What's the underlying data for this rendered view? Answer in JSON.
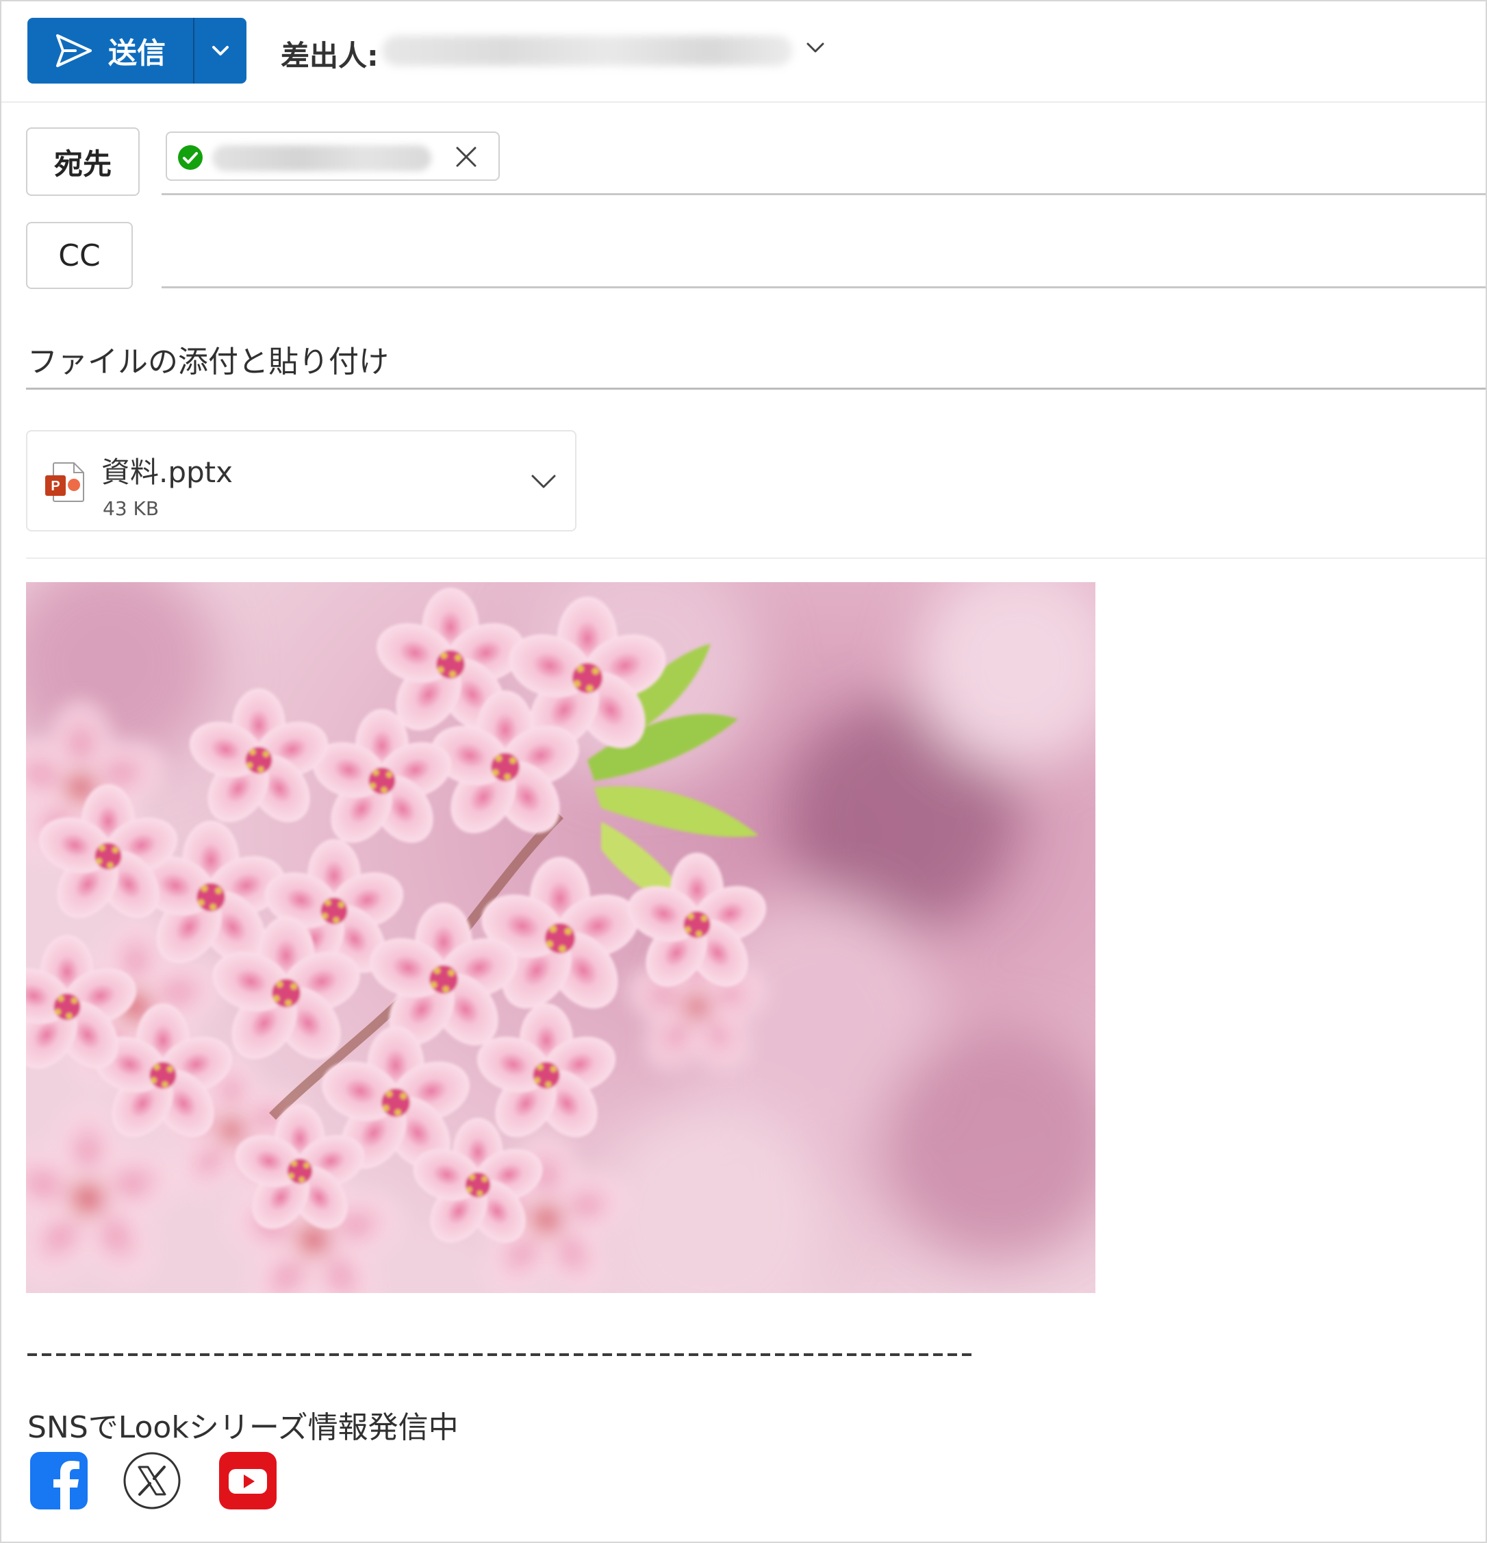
{
  "header": {
    "send_label": "送信",
    "from_label": "差出人:"
  },
  "recipients": {
    "to_label": "宛先",
    "cc_label": "CC"
  },
  "subject": "ファイルの添付と貼り付け",
  "attachment": {
    "file_name": "資料.pptx",
    "file_size": "43 KB",
    "icon": "powerpoint-file-icon"
  },
  "signature": {
    "separator": "-------------------------------------------------------------------",
    "text": "SNSでLookシリーズ情報発信中",
    "social": [
      {
        "icon": "facebook-icon",
        "color": "#1877f2"
      },
      {
        "icon": "x-icon",
        "color": "#333333"
      },
      {
        "icon": "youtube-icon",
        "color": "#e1131a"
      }
    ]
  },
  "colors": {
    "accent": "#0f6cbd",
    "status_ok": "#13a10e"
  }
}
